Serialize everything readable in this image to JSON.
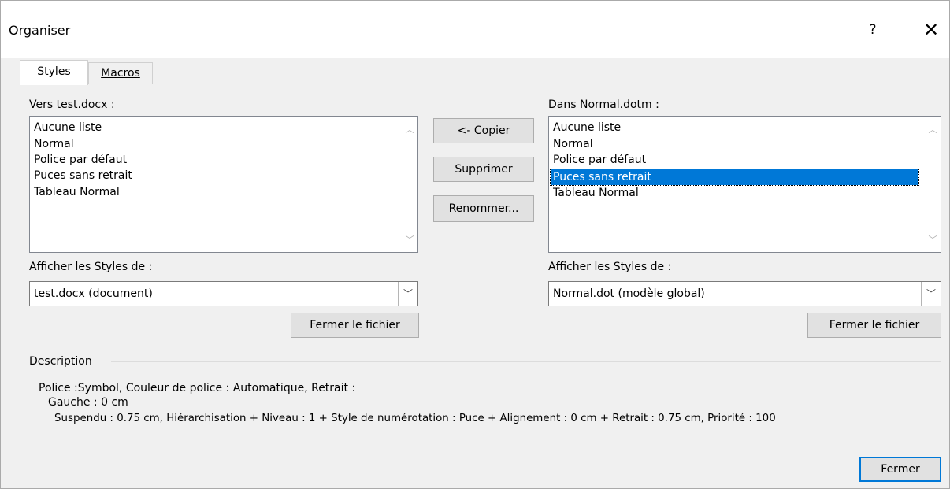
{
  "window": {
    "title": "Organiser",
    "help": "?",
    "close": "✕"
  },
  "tabs": [
    {
      "label": "Styles",
      "accessKey": "S",
      "active": true
    },
    {
      "label": "Macros",
      "accessKey": "M",
      "active": false
    }
  ],
  "left": {
    "label": "Vers test.docx :",
    "items": [
      "Aucune liste",
      "Normal",
      "Police par défaut",
      "Puces sans retrait",
      "Tableau Normal"
    ],
    "show_label": "Afficher les Styles de :",
    "combo_value": "test.docx (document)",
    "close_file_button": "Fermer le fichier"
  },
  "middle": {
    "copy_button": "<- Copier",
    "delete_button": "Supprimer",
    "rename_button": "Renommer..."
  },
  "right": {
    "label": "Dans Normal.dotm :",
    "items": [
      "Aucune liste",
      "Normal",
      "Police par défaut",
      "Puces sans retrait",
      "Tableau Normal"
    ],
    "selected_index": 3,
    "show_label": "Afficher les Styles de :",
    "combo_value": "Normal.dot (modèle global)",
    "close_file_button": "Fermer le fichier"
  },
  "description": {
    "heading": "Description",
    "line1": "Police :Symbol, Couleur de police : Automatique, Retrait :",
    "line2": "Gauche :  0 cm",
    "line3": "Suspendu : 0.75 cm, Hiérarchisation + Niveau : 1 + Style de numérotation : Puce + Alignement :  0 cm + Retrait :  0.75 cm, Priorité : 100"
  },
  "footer": {
    "close_button": "Fermer"
  },
  "colors": {
    "selection": "#0078d7",
    "default_button_border": "#0078d7"
  }
}
